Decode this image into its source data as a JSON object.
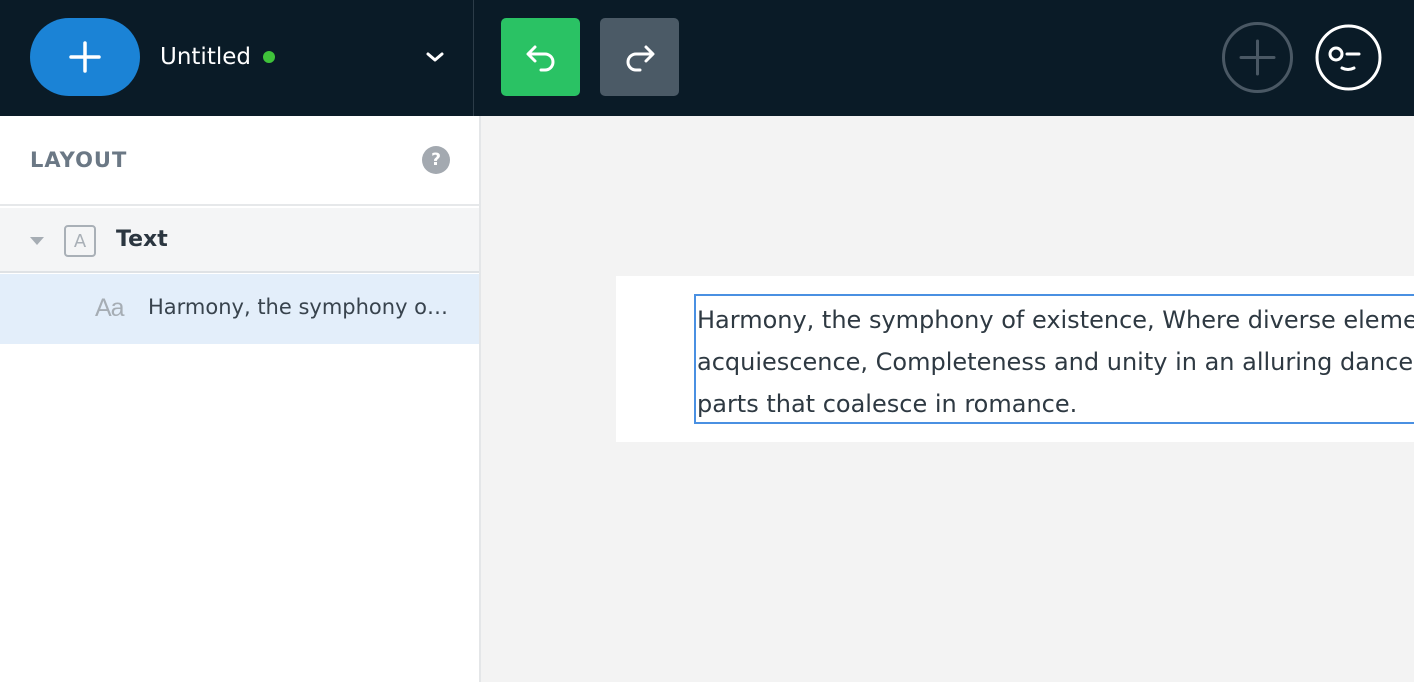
{
  "header": {
    "add_button_icon": "plus-icon",
    "document_title": "Untitled",
    "status_color": "#3fc23a",
    "menu_icon": "chevron-down-icon",
    "undo_icon": "undo-arrow-icon",
    "undo_color": "#2ac264",
    "redo_icon": "redo-arrow-icon",
    "redo_color": "#4b5a66",
    "plus_circle_icon": "plus-circle-icon",
    "user_icon": "user-avatar-icon"
  },
  "sidebar": {
    "title": "LAYOUT",
    "help": "?",
    "tree": [
      {
        "type_icon": "A",
        "label": "Text",
        "expanded": true
      },
      {
        "type_icon": "Aa",
        "label": "Harmony, the symphony of existence, Where diverse elements",
        "selected": true
      }
    ]
  },
  "canvas": {
    "text_lines": [
      "Harmony, the symphony of existence, Where diverse elements",
      "acquiescence, Completeness and unity in an alluring dance,",
      "parts that coalesce in romance."
    ]
  }
}
